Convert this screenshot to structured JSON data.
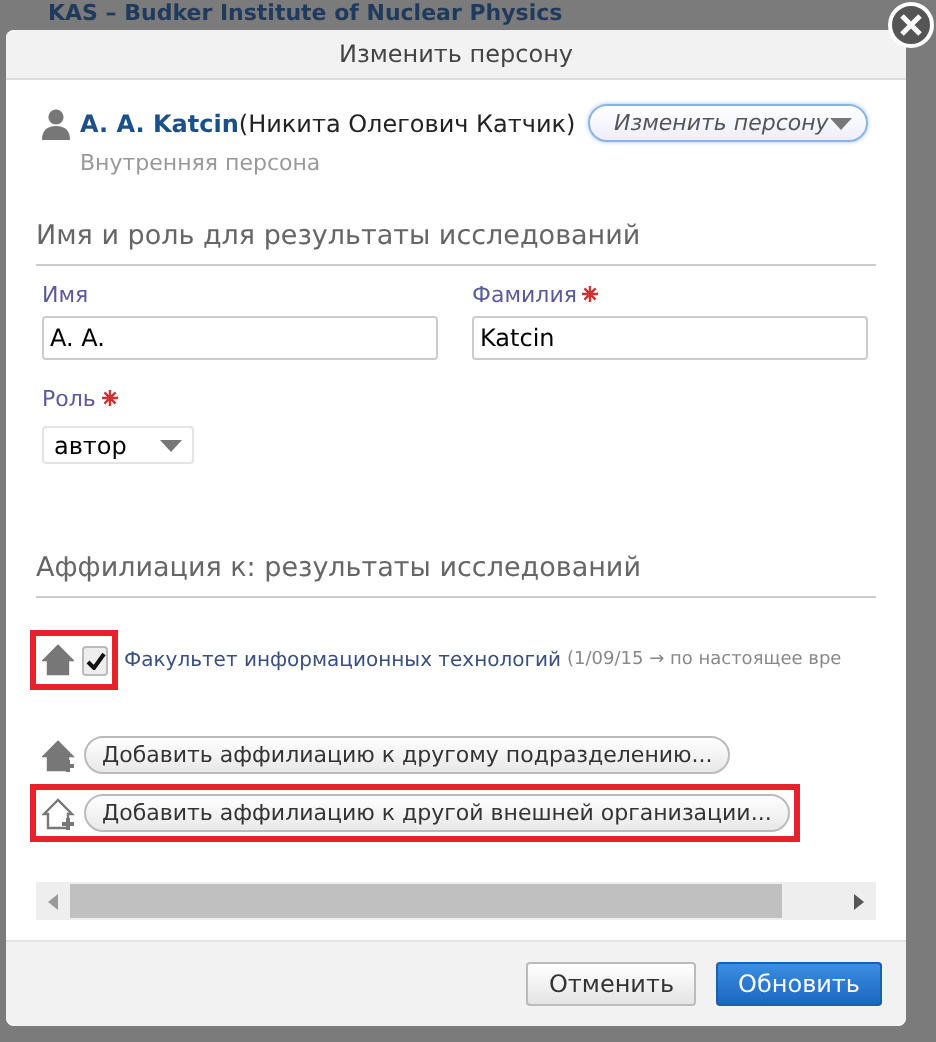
{
  "background": {
    "title": "KAS – Budker Institute of Nuclear Physics"
  },
  "dialog": {
    "title": "Изменить персону",
    "person": {
      "name": "A. A. Katcin",
      "full_name": "(Никита Олегович Катчик)",
      "type": "Внутренняя персона",
      "menu_button": "Изменить персону"
    },
    "name_section": {
      "heading": "Имя и роль для результаты исследований",
      "fields": [
        {
          "label": "Имя",
          "required": false,
          "value": "A. A."
        },
        {
          "label": "Фамилия",
          "required": true,
          "value": "Katcin"
        }
      ],
      "role": {
        "label": "Роль",
        "required": true,
        "value": "автор"
      }
    },
    "affiliation_section": {
      "heading": "Аффилиация к: результаты исследований",
      "affiliations": [
        {
          "name": "Факультет информационных технологий",
          "period": "(1/09/15 → по настоящее вре",
          "checked": true,
          "highlighted": true
        }
      ],
      "add_buttons": [
        {
          "label": "Добавить аффилиацию к другому подразделению...",
          "kind": "internal",
          "highlighted": false
        },
        {
          "label": "Добавить аффилиацию к другой внешней организации...",
          "kind": "external",
          "highlighted": true
        }
      ]
    },
    "buttons": [
      {
        "label": "Отменить",
        "primary": false
      },
      {
        "label": "Обновить",
        "primary": true
      }
    ]
  }
}
